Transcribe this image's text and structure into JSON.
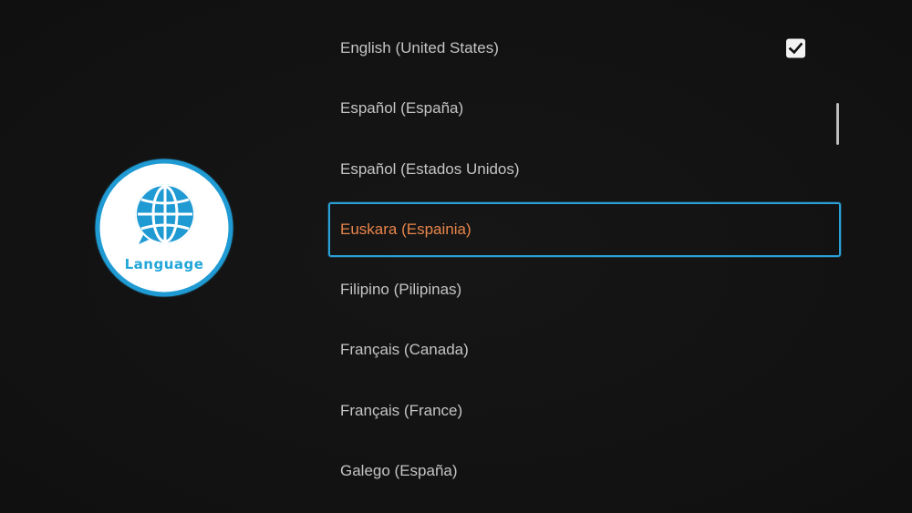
{
  "logo": {
    "icon": "globe-speech-bubble-icon",
    "label": "Language",
    "accent_color": "#22a6d8"
  },
  "languages": [
    {
      "label": "English (United States)",
      "checked": true,
      "focused": false
    },
    {
      "label": "Español (España)",
      "checked": false,
      "focused": false
    },
    {
      "label": "Español (Estados Unidos)",
      "checked": false,
      "focused": false
    },
    {
      "label": "Euskara (Espainia)",
      "checked": false,
      "focused": true
    },
    {
      "label": "Filipino (Pilipinas)",
      "checked": false,
      "focused": false
    },
    {
      "label": "Français (Canada)",
      "checked": false,
      "focused": false
    },
    {
      "label": "Français (France)",
      "checked": false,
      "focused": false
    },
    {
      "label": "Galego (España)",
      "checked": false,
      "focused": false
    }
  ],
  "colors": {
    "background": "#121212",
    "focus_border": "#2aa0d6",
    "focus_text": "#e8854a",
    "text": "#c4c4c4"
  }
}
